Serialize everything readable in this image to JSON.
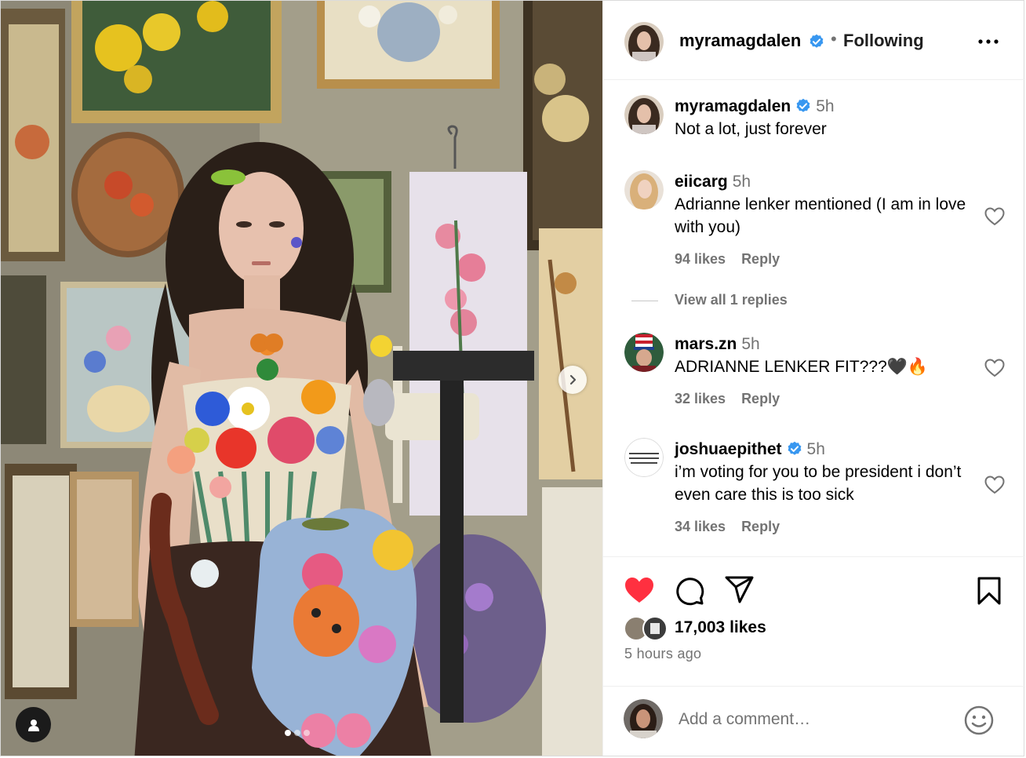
{
  "post": {
    "author": "myramagdalen",
    "separator": "•",
    "follow_status": "Following",
    "caption": {
      "username": "myramagdalen",
      "time": "5h",
      "text": "Not a lot, just forever"
    },
    "comments": [
      {
        "username": "eiicarg",
        "time": "5h",
        "verified": false,
        "text": "Adrianne lenker mentioned (I am in love with you)",
        "likes": "94 likes",
        "reply": "Reply"
      },
      {
        "username": "mars.zn",
        "time": "5h",
        "verified": false,
        "text": "ADRIANNE LENKER FIT???🖤🔥",
        "likes": "32 likes",
        "reply": "Reply"
      },
      {
        "username": "joshuaepithet",
        "time": "5h",
        "verified": true,
        "text": "i’m voting for you to be president i don’t even care this is too sick",
        "likes": "34 likes",
        "reply": "Reply"
      }
    ],
    "view_replies": "View all 1 replies",
    "likes_total": "17,003 likes",
    "posted_ago": "5 hours ago",
    "comment_placeholder": "Add a comment…",
    "carousel": {
      "slides": 3,
      "current": 1
    }
  },
  "colors": {
    "verified_blue": "#3897f0",
    "like_red": "#ff3040",
    "secondary_text": "#737373"
  },
  "icons": [
    "verified-badge-icon",
    "more-options-icon",
    "heart-icon",
    "comment-icon",
    "share-icon",
    "bookmark-icon",
    "emoji-icon",
    "chevron-right-icon",
    "user-tag-icon"
  ]
}
